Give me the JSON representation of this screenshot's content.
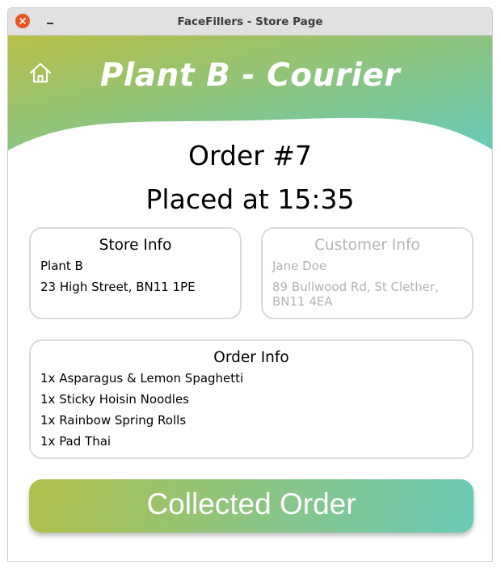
{
  "window": {
    "title": "FaceFillers - Store Page"
  },
  "header": {
    "store_title": "Plant B - Courier",
    "home_icon": "home-icon",
    "gradient": [
      "#b7bf47",
      "#8cc47f",
      "#67cbb9"
    ]
  },
  "order": {
    "number_label": "Order #7",
    "placed_label": "Placed at 15:35"
  },
  "store_info": {
    "heading": "Store Info",
    "name": "Plant B",
    "address": "23 High Street, BN11 1PE"
  },
  "customer_info": {
    "heading": "Customer Info",
    "name": "Jane Doe",
    "address_line1": "89 Bullwood Rd, St Clether,",
    "address_line2": "BN11 4EA"
  },
  "order_info": {
    "heading": "Order Info",
    "items": [
      "1x Asparagus & Lemon Spaghetti",
      "1x Sticky Hoisin Noodles",
      "1x Rainbow Spring Rolls",
      "1x Pad Thai"
    ]
  },
  "action": {
    "collected_label": "Collected Order"
  },
  "colors": {
    "close_button": "#e95420",
    "disabled_text": "#b3b3b3",
    "card_border": "#dadada"
  }
}
